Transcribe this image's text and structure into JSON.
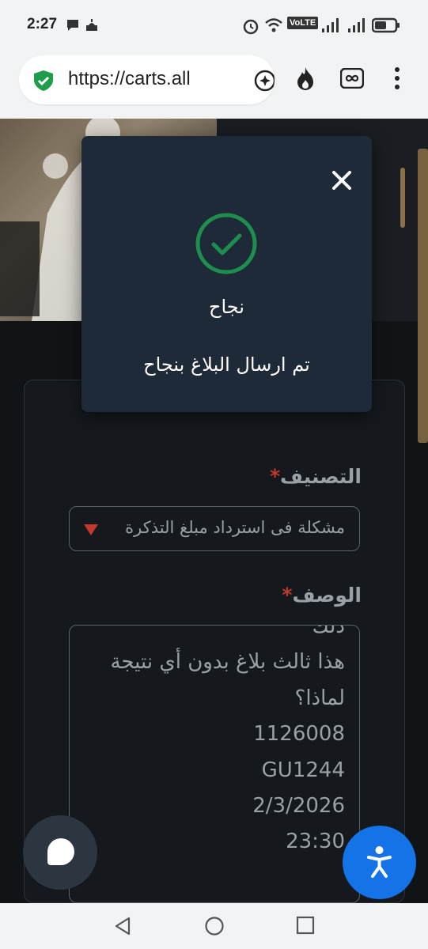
{
  "status_bar": {
    "time": "2:27",
    "network_label": "VoLTE"
  },
  "browser": {
    "url": "https://carts.all",
    "icons": [
      "shield-check-icon",
      "sparkle-chat-icon",
      "fire-icon",
      "infinity-icon",
      "more-vert-icon"
    ]
  },
  "form": {
    "category_label": "التصنيف",
    "category_value": "مشكلة فى استرداد مبلغ التذكرة",
    "description_label": "الوصف",
    "description_lines": [
      "ذلك",
      "هذا ثالث بلاغ بدون أي نتيجة",
      "لماذا؟",
      "1126008",
      "GU1244",
      "2/3/2026",
      "23:30"
    ],
    "required_mark": "*"
  },
  "modal": {
    "title": "نجاح",
    "message": "تم ارسال البلاغ بنجاح",
    "icon": "check-circle-icon",
    "accent_color": "#1e8e4e"
  },
  "colors": {
    "page_bg": "#111417",
    "modal_bg": "#1f2a38",
    "accessibility_button": "#1473e6",
    "required": "#c0392b",
    "hero_accent": "#8b6f47"
  }
}
